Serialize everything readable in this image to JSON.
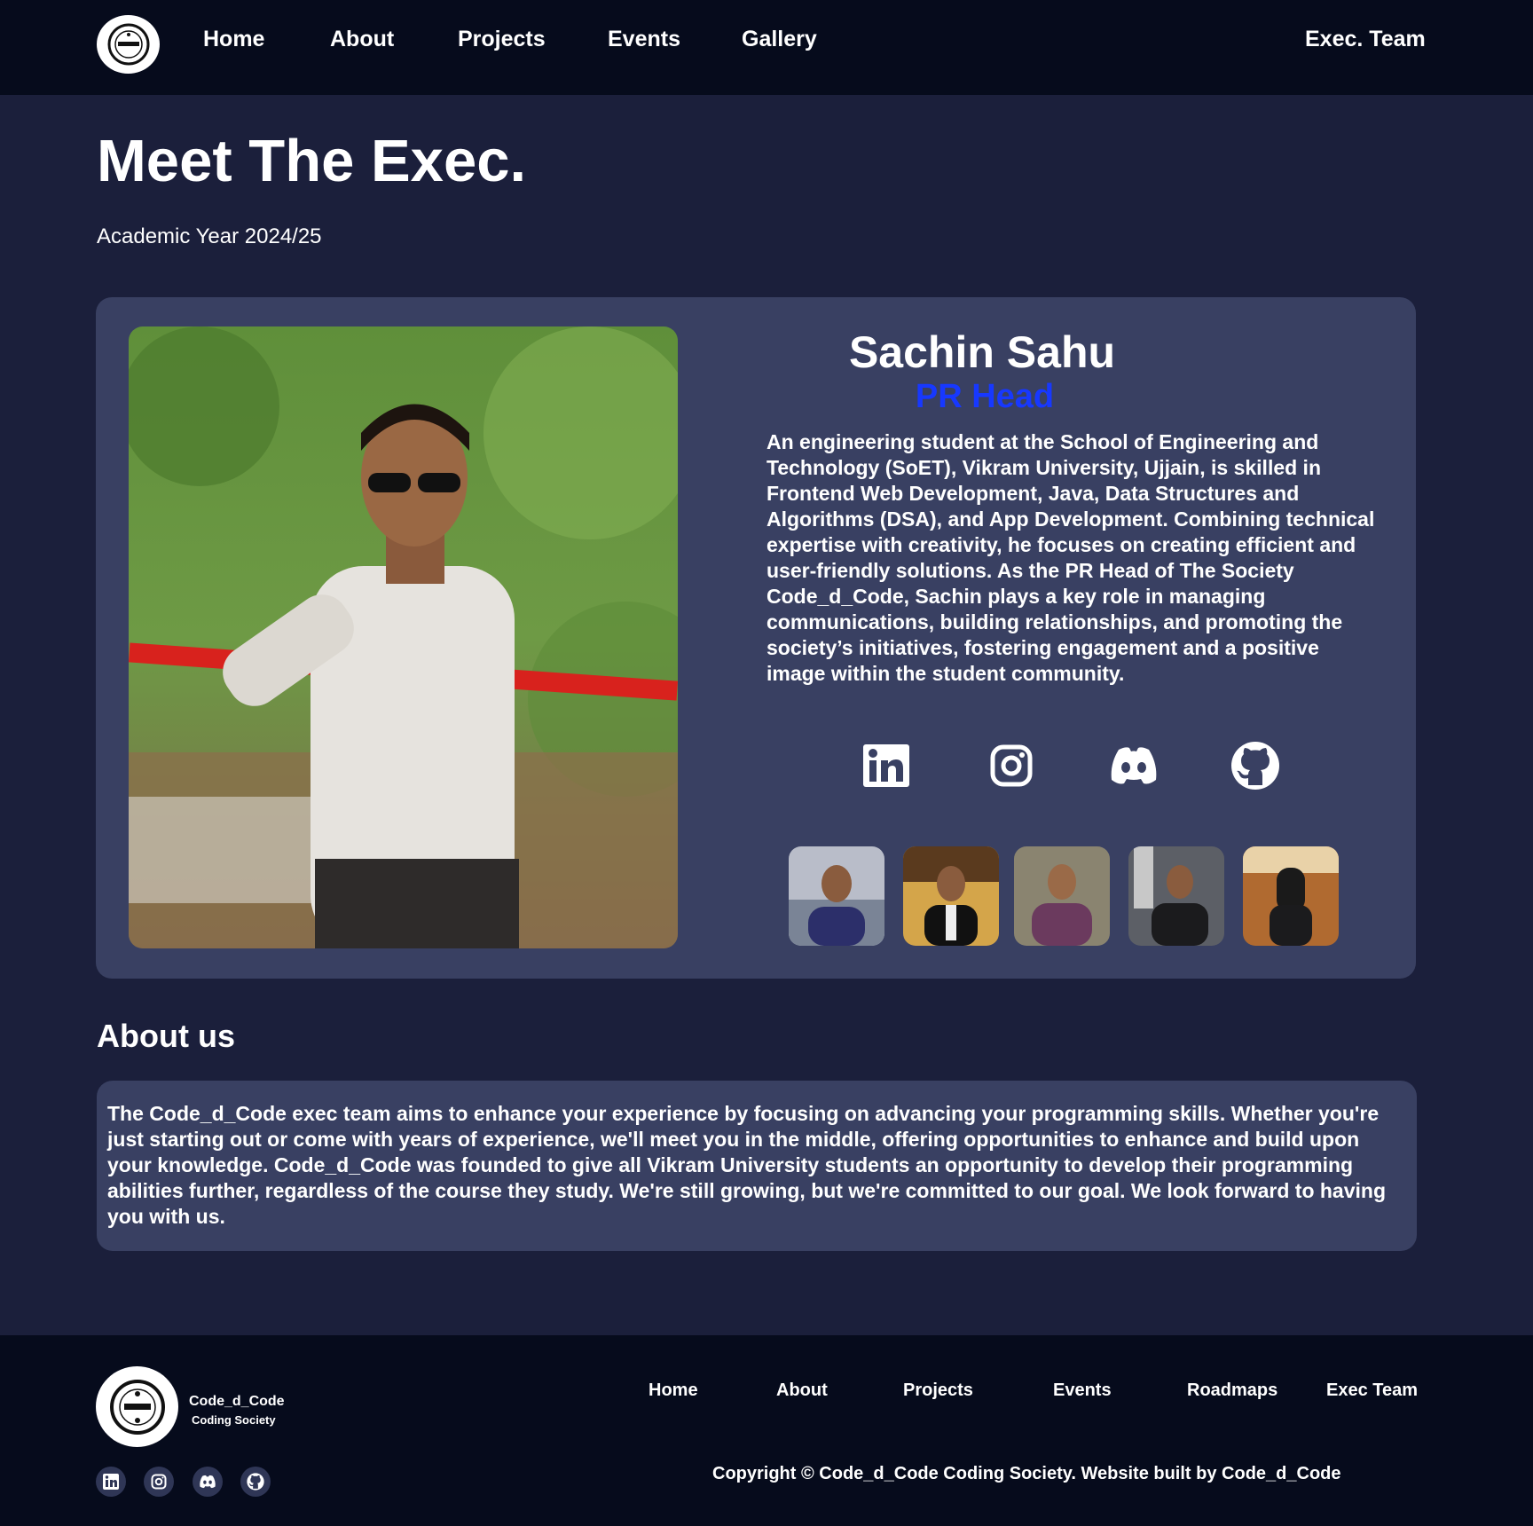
{
  "nav": {
    "logo_icon": "club-logo-icon",
    "links": [
      "Home",
      "About",
      "Projects",
      "Events",
      "Gallery"
    ],
    "exec_link": "Exec. Team"
  },
  "hero": {
    "title": "Meet The Exec.",
    "subtitle": "Academic Year 2024/25"
  },
  "profile": {
    "name": "Sachin Sahu",
    "role": "PR Head",
    "bio": "An engineering student at the School of Engineering and Technology (SoET), Vikram University, Ujjain, is skilled in Frontend Web Development, Java, Data Structures and Algorithms (DSA), and App Development. Combining technical expertise with creativity, he focuses on creating efficient and user-friendly solutions. As the PR Head of The Society Code_d_Code, Sachin plays a key role in managing communications, building relationships, and promoting the society’s initiatives, fostering engagement and a positive image within the student community.",
    "socials": [
      "linkedin-icon",
      "instagram-icon",
      "discord-icon",
      "github-icon"
    ],
    "thumbnails_count": 5
  },
  "about": {
    "heading": "About us",
    "text": "The Code_d_Code exec team aims to enhance your experience by focusing on advancing your programming skills. Whether you're just starting out or come with years of experience, we'll meet you in the middle, offering opportunities to enhance and build upon your knowledge. Code_d_Code was founded to give all Vikram University students an opportunity to develop their programming abilities further, regardless of the course they study. We're still growing, but we're committed to our goal. We look forward to having you with us."
  },
  "footer": {
    "brand": "Code_d_Code",
    "tagline": "Coding Society",
    "links": [
      "Home",
      "About",
      "Projects",
      "Events",
      "Roadmaps",
      "Exec Team"
    ],
    "copyright": "Copyright © Code_d_Code  Coding Society. Website built by Code_d_Code"
  },
  "colors": {
    "nav_bg": "#060b1c",
    "page_bg": "#1b1f3b",
    "card_bg": "#394062",
    "role_accent": "#1738ff"
  }
}
